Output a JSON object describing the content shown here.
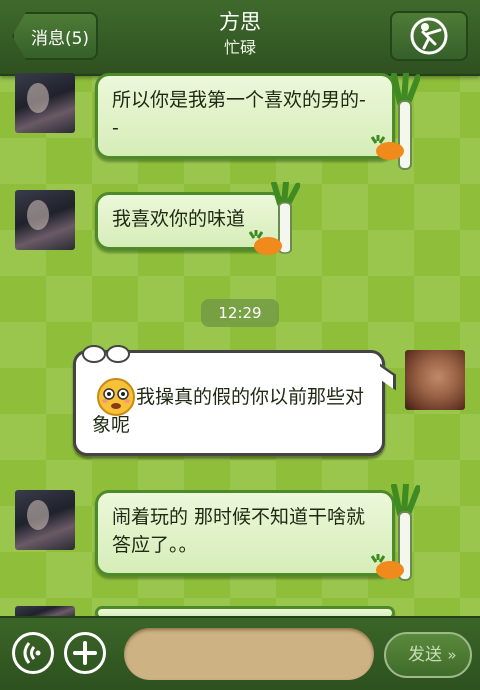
{
  "header": {
    "back_label": "消息(5)",
    "title": "方思",
    "subtitle": "忙碌"
  },
  "messages": [
    {
      "sender": "her",
      "text": "所以你是我第一个喜欢的男的- -"
    },
    {
      "sender": "her",
      "text": "我喜欢你的味道"
    },
    {
      "sender": "me",
      "text": "我操真的假的你以前那些对象呢"
    },
    {
      "sender": "her",
      "text": "闹着玩的 那时候不知道干啥就答应了。。"
    }
  ],
  "timestamp": "12:29",
  "footer": {
    "send_label": "发送",
    "voice_icon": "voice-icon",
    "add_icon": "plus-icon"
  },
  "colors": {
    "header": "#35602a",
    "bubble_border": "#4d8a2a",
    "background": "#8fbf3a"
  }
}
